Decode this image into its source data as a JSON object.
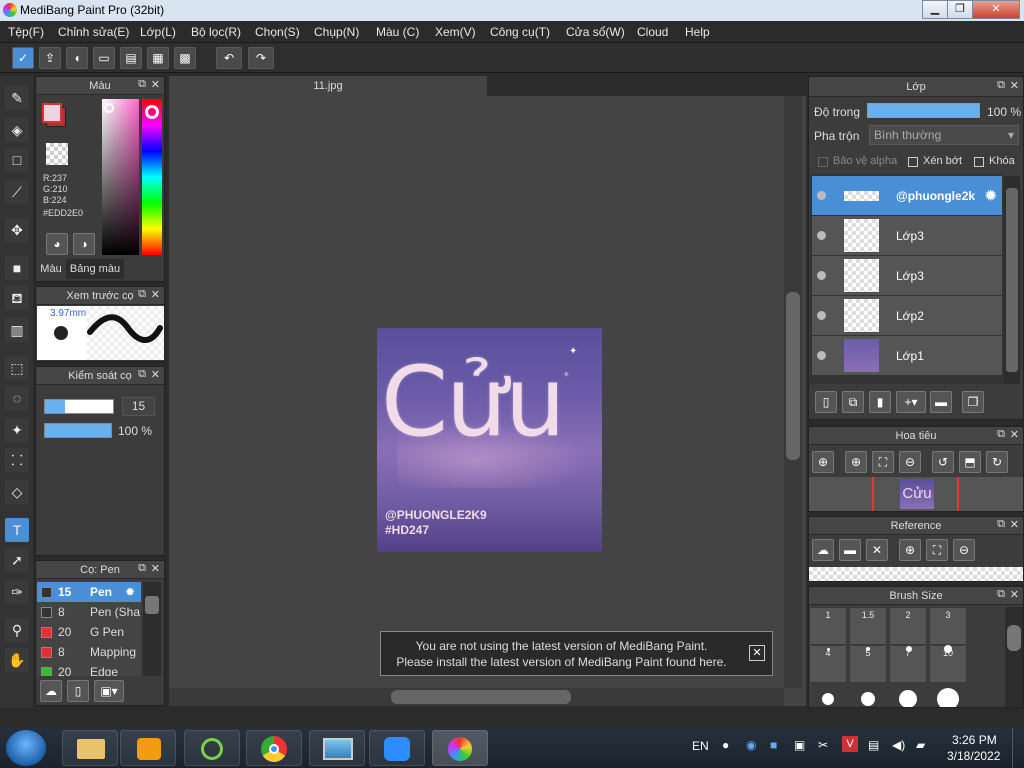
{
  "window": {
    "title": "MediBang Paint Pro (32bit)",
    "min": "▁",
    "max": "❐",
    "close": "✕"
  },
  "menu": [
    "Tệp(F)",
    "Chỉnh sửa(E)",
    "Lớp(L)",
    "Bộ lọc(R)",
    "Chọn(S)",
    "Chụp(N)",
    "Màu (C)",
    "Xem(V)",
    "Công cụ(T)",
    "Cửa sổ(W)",
    "Cloud",
    "Help"
  ],
  "canvas": {
    "tab": "11.jpg",
    "art_text": "Cửu",
    "watermark1": "@PHUONGLE2K9",
    "watermark2": "#HD247"
  },
  "notice": {
    "line1": "You are not using the latest version of MediBang Paint.",
    "line2": "Please install the latest version of MediBang Paint found here.",
    "close": "✕"
  },
  "color_panel": {
    "title": "Màu",
    "r": "R:237",
    "g": "G:210",
    "b": "B:224",
    "hex": "#EDD2E0",
    "tab1": "Màu",
    "tab2": "Bảng màu",
    "accent": "#4a8fd6"
  },
  "brush_preview": {
    "title": "Xem trước cọ",
    "size": "3.97mm"
  },
  "brush_control": {
    "title": "Kiểm soát cọ",
    "size": "15",
    "opacity": "100 %"
  },
  "brush_list": {
    "title": "Cọ: Pen",
    "items": [
      {
        "size": "15",
        "name": "Pen",
        "color": "#333333"
      },
      {
        "size": "8",
        "name": "Pen (Sha",
        "color": "#333333"
      },
      {
        "size": "20",
        "name": "G Pen",
        "color": "#e03030"
      },
      {
        "size": "8",
        "name": "Mapping P",
        "color": "#e03030"
      },
      {
        "size": "20",
        "name": "Edge Pen",
        "color": "#30c030"
      }
    ]
  },
  "layers": {
    "title": "Lớp",
    "opacity_label": "Độ trong",
    "opacity_value": "100 %",
    "blend_label": "Pha trộn",
    "blend_value": "Bình thường",
    "protect_alpha": "Bảo vệ alpha",
    "clipping": "Xén bớt",
    "lock": "Khóa",
    "items": [
      "@phuongle2k",
      "Lớp3",
      "Lớp3",
      "Lớp2",
      "Lớp1"
    ]
  },
  "navigator": {
    "title": "Hoa tiêu",
    "thumb_text": "Cửu"
  },
  "reference": {
    "title": "Reference"
  },
  "brush_size": {
    "title": "Brush Size",
    "sizes": [
      "1",
      "1.5",
      "2",
      "3",
      "4",
      "5",
      "7",
      "10"
    ]
  },
  "taskbar": {
    "lang": "EN",
    "time": "3:26 PM",
    "date": "3/18/2022"
  }
}
